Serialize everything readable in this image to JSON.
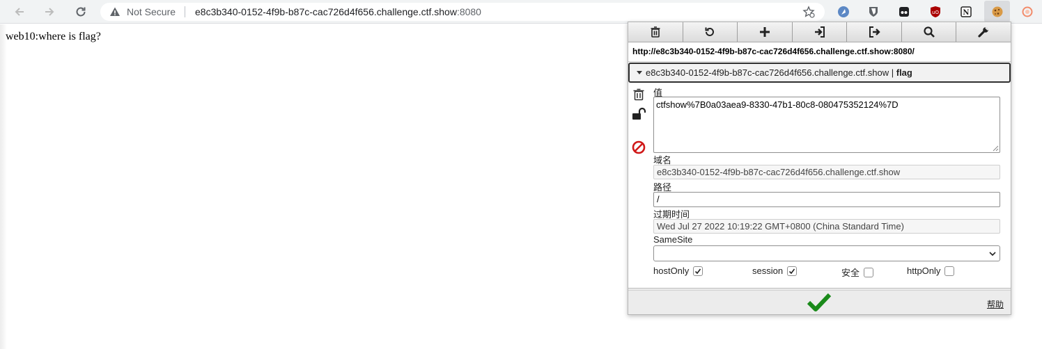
{
  "browser": {
    "security_label": "Not Secure",
    "url_host": "e8c3b340-0152-4f9b-b87c-cac726d4f656.challenge.ctf.show",
    "url_port": ":8080",
    "extensions": [
      "reader-icon",
      "bitwarden-icon",
      "tab-icon",
      "ublock-icon",
      "notion-icon",
      "cookie-editor-icon",
      "record-icon"
    ]
  },
  "page": {
    "body_text": "web10:where is flag?"
  },
  "cookie_editor": {
    "toolbar": [
      "delete-all",
      "refresh",
      "add",
      "import",
      "export",
      "search",
      "settings"
    ],
    "site_url": "http://e8c3b340-0152-4f9b-b87c-cac726d4f656.challenge.ctf.show:8080/",
    "cookie_domain": "e8c3b340-0152-4f9b-b87c-cac726d4f656.challenge.ctf.show",
    "cookie_separator": "|",
    "cookie_name": "flag",
    "labels": {
      "value": "值",
      "domain": "域名",
      "path": "路径",
      "expires": "过期时间",
      "samesite": "SameSite",
      "host_only": "hostOnly",
      "session": "session",
      "secure": "安全",
      "http_only": "httpOnly",
      "help": "帮助"
    },
    "fields": {
      "value": "ctfshow%7B0a03aea9-8330-47b1-80c8-080475352124%7D",
      "domain": "e8c3b340-0152-4f9b-b87c-cac726d4f656.challenge.ctf.show",
      "path": "/",
      "expires": "Wed Jul 27 2022 10:19:22 GMT+0800 (China Standard Time)",
      "samesite": ""
    },
    "flags": {
      "host_only": true,
      "session": true,
      "secure": false,
      "http_only": false
    },
    "colors": {
      "ok_green": "#1a8a1a",
      "block_red": "#d01818"
    }
  }
}
